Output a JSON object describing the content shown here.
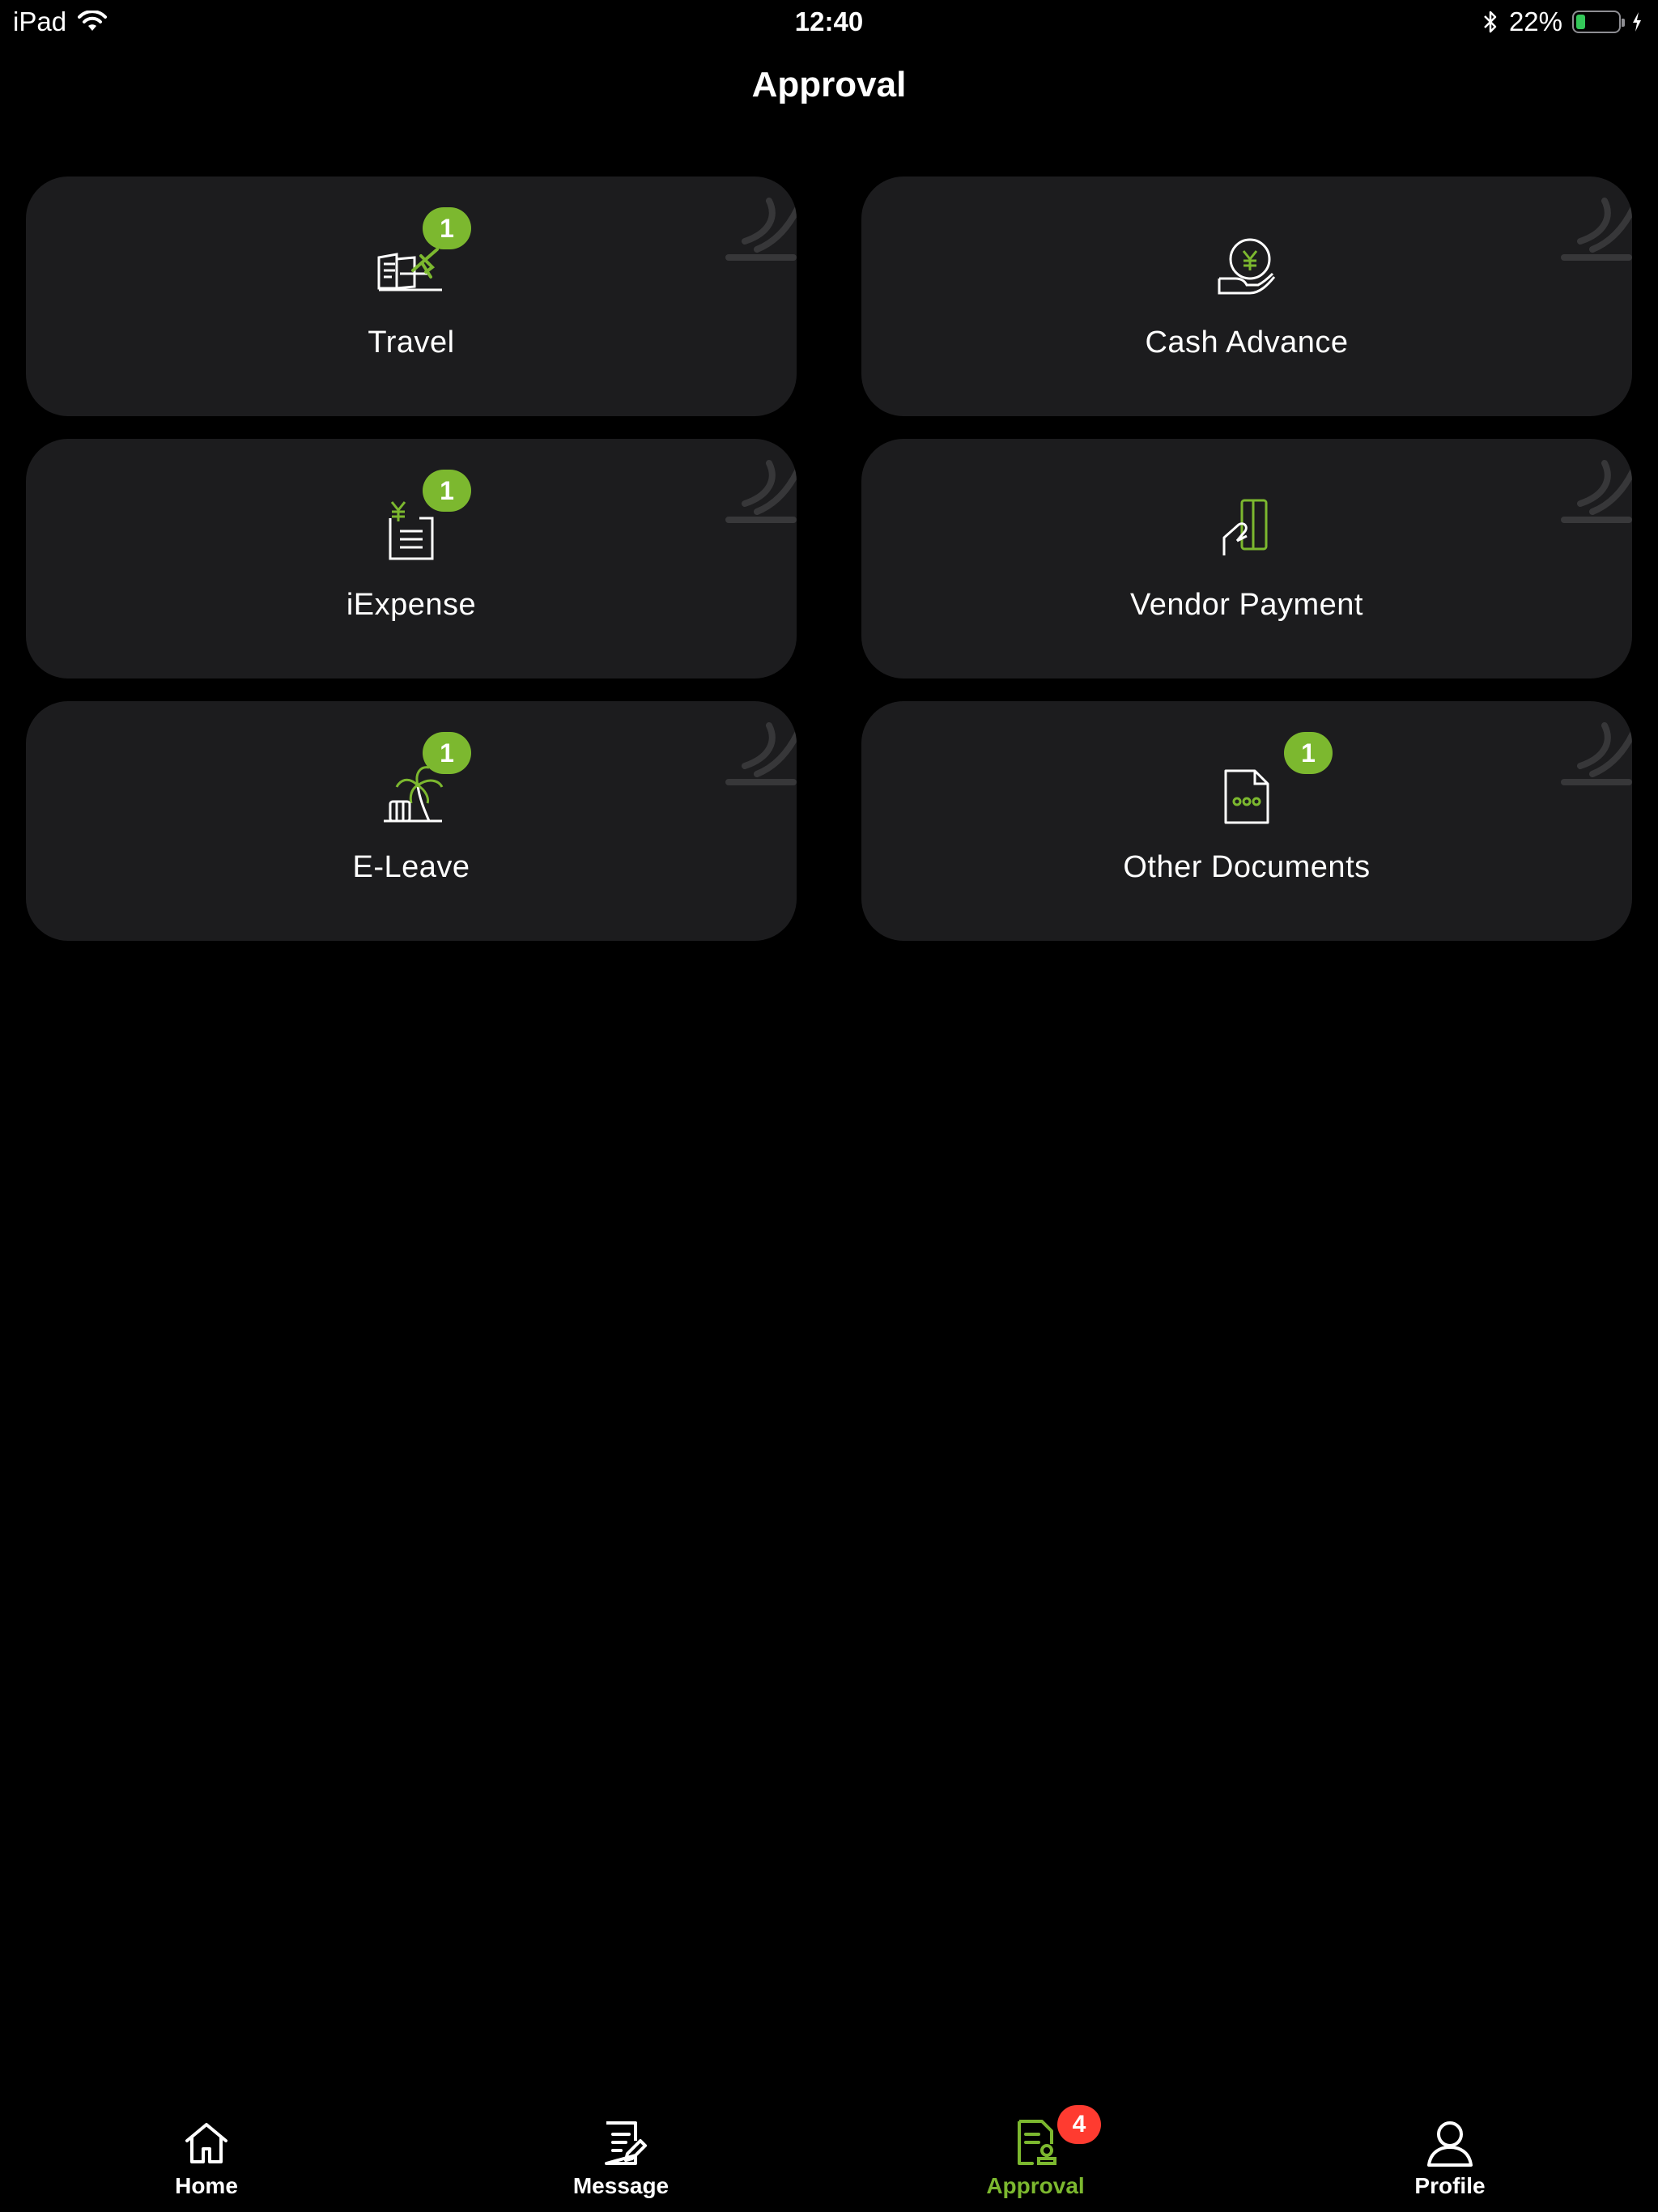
{
  "status_bar": {
    "device": "iPad",
    "time": "12:40",
    "battery_percent_label": "22%",
    "battery_level": 0.22,
    "icons": [
      "wifi-icon",
      "bluetooth-icon",
      "battery-icon",
      "charging-icon"
    ]
  },
  "header": {
    "title": "Approval"
  },
  "cards": [
    {
      "label": "Travel",
      "badge": "1",
      "icon": "travel-plane-icon"
    },
    {
      "label": "Cash Advance",
      "badge": "",
      "icon": "cash-hand-icon"
    },
    {
      "label": "iExpense",
      "badge": "1",
      "icon": "expense-receipt-icon"
    },
    {
      "label": "Vendor Payment",
      "badge": "",
      "icon": "vendor-card-icon"
    },
    {
      "label": "E-Leave",
      "badge": "1",
      "icon": "palm-tree-icon"
    },
    {
      "label": "Other Documents",
      "badge": "1",
      "icon": "document-icon"
    }
  ],
  "tab_bar": {
    "tabs": [
      {
        "label": "Home",
        "icon": "home-icon",
        "active": false
      },
      {
        "label": "Message",
        "icon": "message-edit-icon",
        "active": false
      },
      {
        "label": "Approval",
        "icon": "approval-document-icon",
        "active": true,
        "badge": "4"
      },
      {
        "label": "Profile",
        "icon": "profile-icon",
        "active": false
      }
    ]
  },
  "colors": {
    "background": "#000000",
    "card": "#1c1c1e",
    "accent_green": "#7cb82f",
    "badge_red": "#ff3b30"
  }
}
